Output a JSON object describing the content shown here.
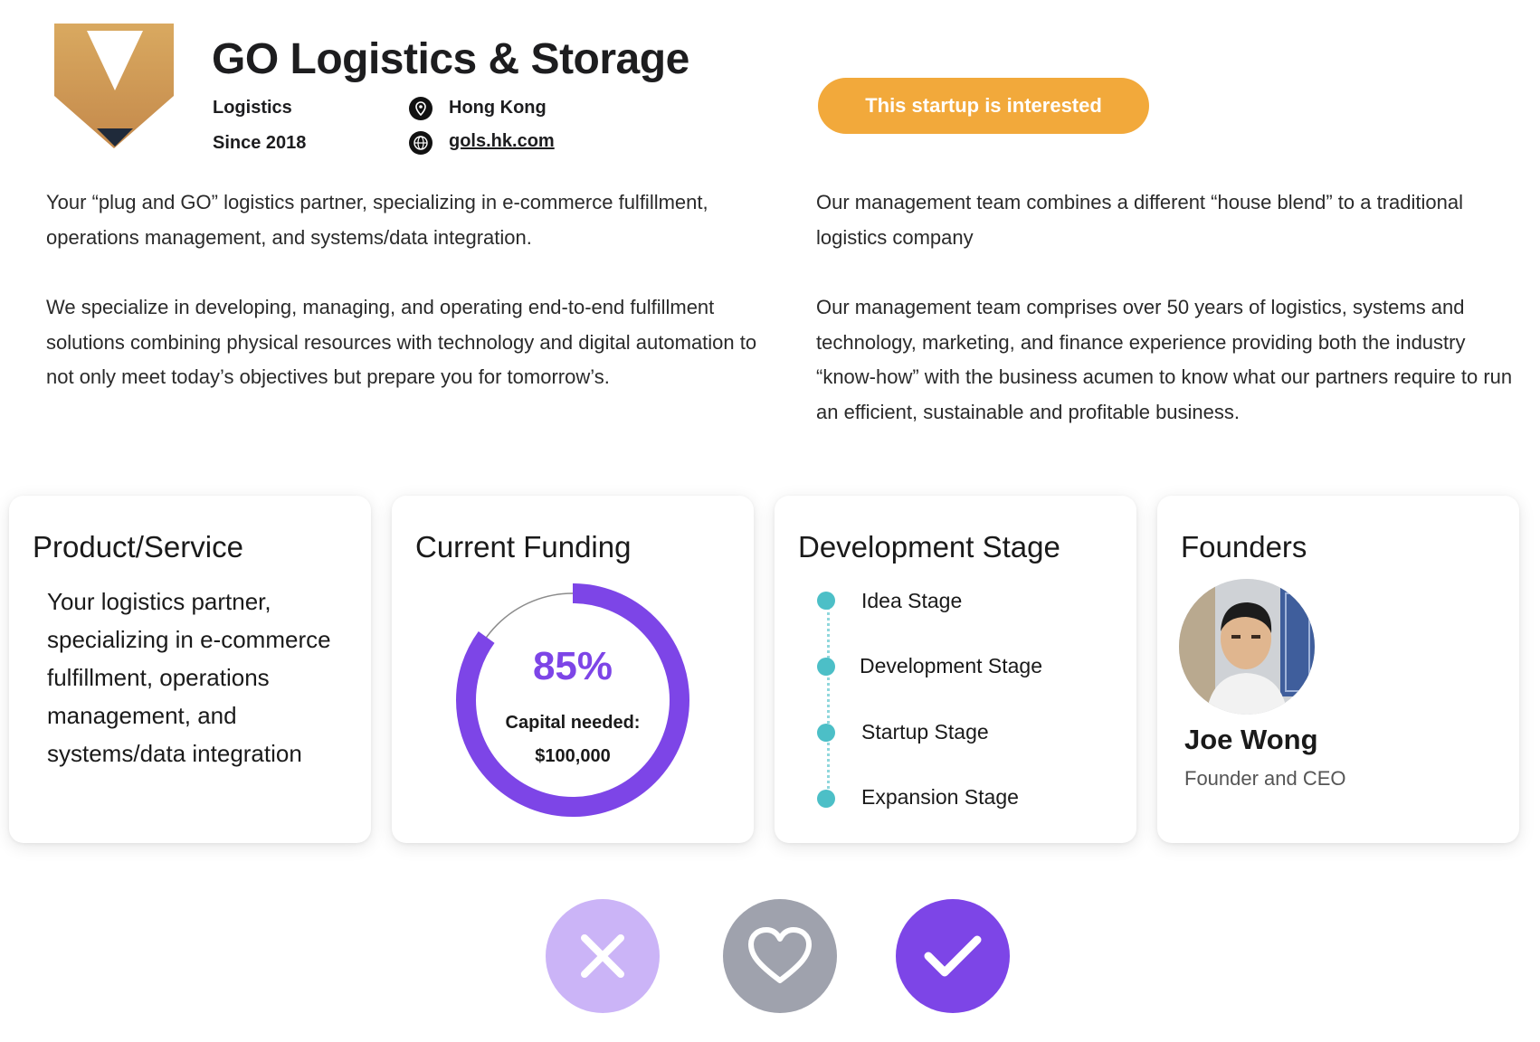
{
  "company": {
    "name": "GO Logistics & Storage",
    "industry": "Logistics",
    "since": "Since  2018",
    "location": "Hong Kong",
    "website": "gols.hk.com",
    "logo_icon": "chevron-v-logo"
  },
  "cta_label": "This startup is interested",
  "about": {
    "left": [
      "Your “plug and GO” logistics partner, specializing in e-commerce fulfillment, operations management, and systems/data integration.",
      "We specialize in developing, managing, and operating end-to-end fulfillment solutions combining physical resources with technology and digital automation to not only meet today’s objectives but prepare you for tomorrow’s."
    ],
    "right": [
      "Our management team combines a different “house blend” to a traditional logistics company",
      "Our management team comprises over 50 years of logistics, systems and technology, marketing, and finance experience providing both the industry “know-how” with the business acumen to know what our partners require to run an efficient, sustainable and profitable business."
    ]
  },
  "cards": {
    "product": {
      "title": "Product/Service",
      "text": "Your logistics partner, specializing in e-commerce fulfillment, operations management, and systems/data integration"
    },
    "funding": {
      "title": "Current Funding",
      "percent_label": "85%",
      "percent": 85,
      "capital_label": "Capital needed:",
      "capital_value": "$100,000"
    },
    "stage": {
      "title": "Development Stage",
      "stages": [
        "Idea Stage",
        "Development Stage",
        "Startup Stage",
        "Expansion Stage"
      ]
    },
    "founders": {
      "title": "Founders",
      "name": "Joe Wong",
      "role": "Founder and CEO"
    }
  },
  "actions": [
    {
      "icon": "close-icon",
      "name": "reject"
    },
    {
      "icon": "heart-icon",
      "name": "favorite"
    },
    {
      "icon": "check-icon",
      "name": "accept"
    }
  ],
  "colors": {
    "accent_purple": "#7d45e7",
    "cta_orange": "#f2a93b",
    "stage_teal": "#4cbfc7",
    "reject_bg": "#cbb4f7",
    "favorite_bg": "#9fa2ad"
  }
}
